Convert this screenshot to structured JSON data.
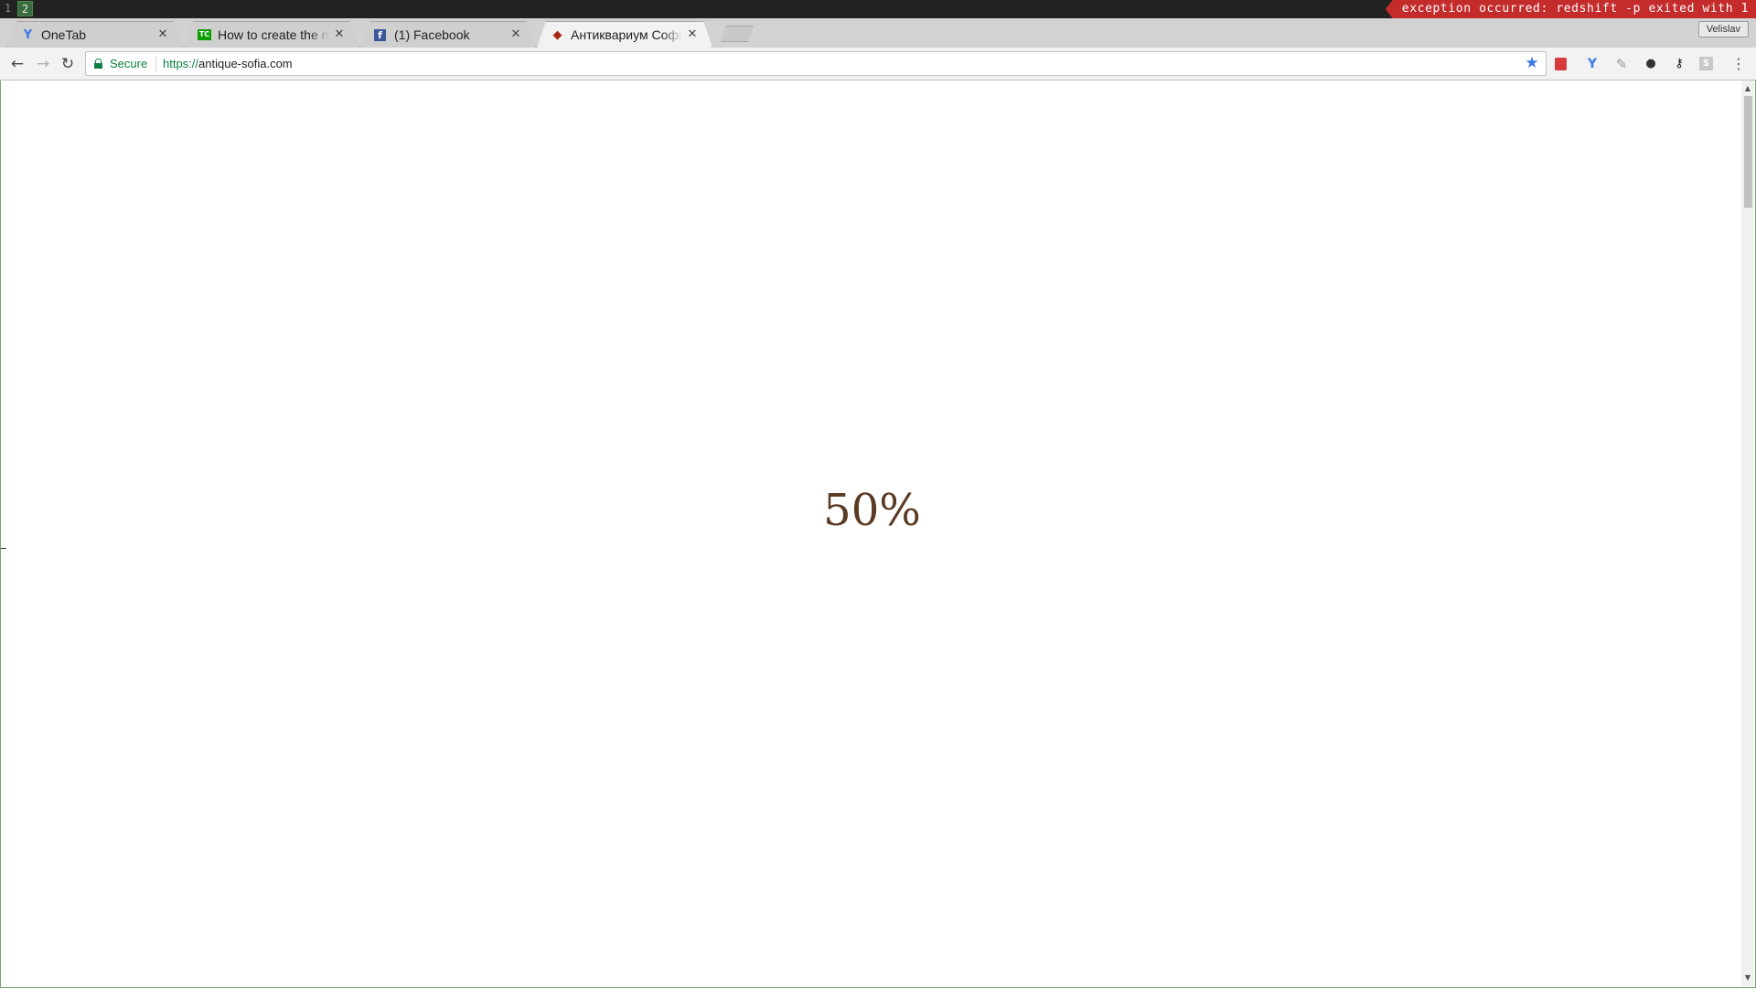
{
  "i3bar": {
    "workspaces": [
      "1",
      "2"
    ],
    "active_workspace": "2",
    "status_text": "exception occurred: redshift -p exited with 1",
    "status_color": "#c42b2b"
  },
  "browser": {
    "tabs": [
      {
        "title": "OneTab",
        "icon": "onetab-icon",
        "active": false
      },
      {
        "title": "How to create the n",
        "icon": "techcrunch-icon",
        "active": false
      },
      {
        "title": "(1) Facebook",
        "icon": "facebook-icon",
        "active": false
      },
      {
        "title": "Антиквариум Софи",
        "icon": "antique-diamond-icon",
        "active": true
      }
    ],
    "profile_name": "Velislav",
    "toolbar": {
      "secure_label": "Secure",
      "url_scheme": "https://",
      "url_host": "antique-sofia.com",
      "bookmarked": true
    },
    "extensions": [
      "pocket-icon",
      "onetab-icon",
      "pencil-icon",
      "incognito-icon",
      "key-icon",
      "s-extension-icon"
    ]
  },
  "page": {
    "loading_percent_text": "50%",
    "loading_color": "#5a3a22"
  }
}
